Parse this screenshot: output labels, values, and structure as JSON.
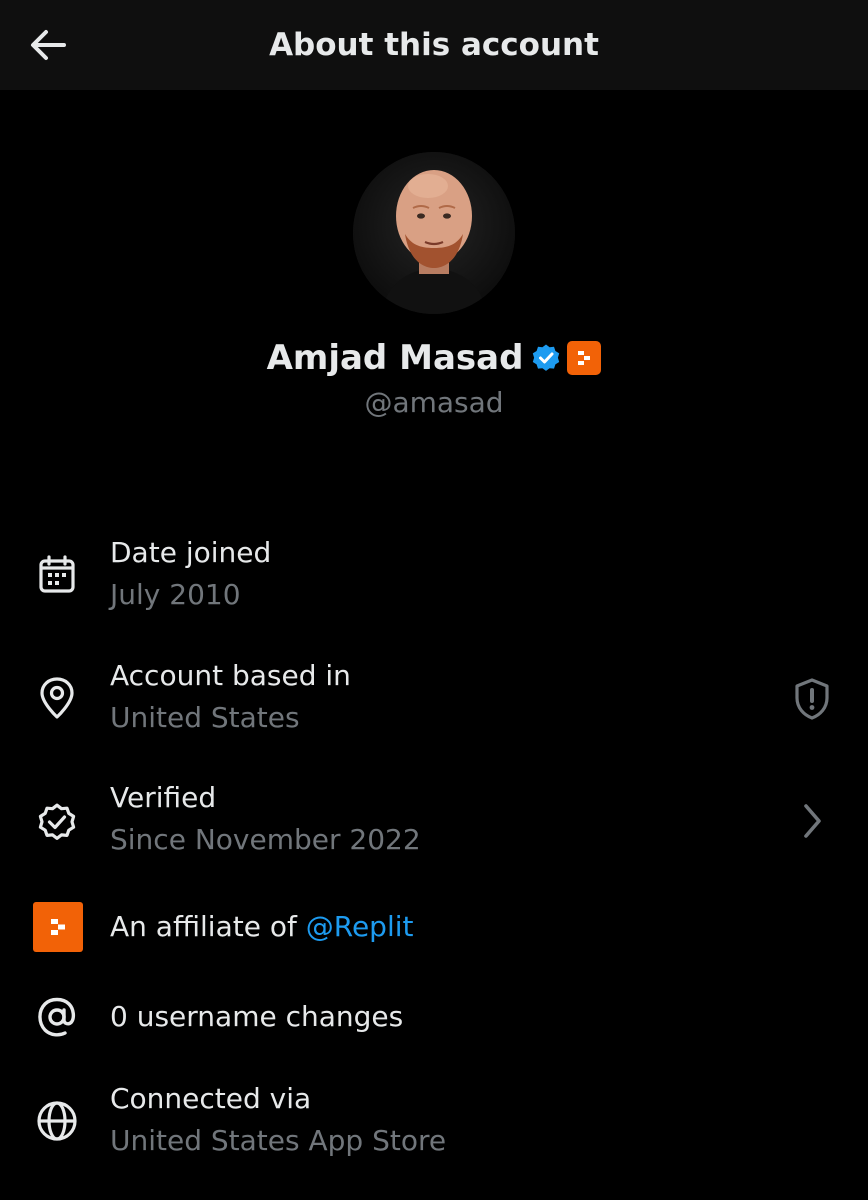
{
  "header": {
    "title": "About this account"
  },
  "profile": {
    "display_name": "Amjad Masad",
    "handle": "@amasad",
    "verified": true,
    "affiliate_badge_color": "#f26207"
  },
  "details": {
    "date_joined": {
      "title": "Date joined",
      "value": "July 2010",
      "icon": "calendar-icon"
    },
    "based_in": {
      "title": "Account based in",
      "value": "United States",
      "icon": "location-pin-icon",
      "right_icon": "shield-alert-icon"
    },
    "verified": {
      "title": "Verified",
      "value": "Since November 2022",
      "icon": "verified-outline-icon",
      "right_icon": "chevron-right-icon"
    },
    "affiliate": {
      "prefix": "An affiliate of ",
      "link": "@Replit",
      "icon": "replit-logo"
    },
    "username_changes": {
      "title": "0 username changes",
      "icon": "at-sign-icon"
    },
    "connected_via": {
      "title": "Connected via",
      "value": "United States App Store",
      "icon": "globe-icon"
    }
  },
  "colors": {
    "background": "#000000",
    "header_background": "#0f0f0f",
    "primary_text": "#e7e9ea",
    "secondary_text": "#71767b",
    "link": "#1d9bf0",
    "verified_blue": "#1d9bf0",
    "replit_orange": "#f26207"
  }
}
